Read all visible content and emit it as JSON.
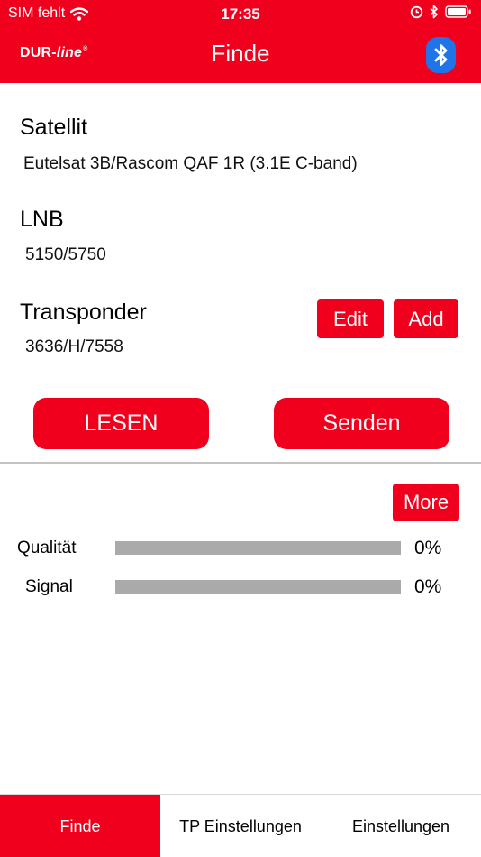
{
  "status_bar": {
    "carrier": "SIM fehlt",
    "time": "17:35"
  },
  "nav": {
    "brand_main": "DUR-",
    "brand_script": "line",
    "brand_mark": "®",
    "title": "Finde"
  },
  "satellite": {
    "label": "Satellit",
    "value": "Eutelsat 3B/Rascom QAF 1R (3.1E C-band)"
  },
  "lnb": {
    "label": "LNB",
    "value": "5150/5750"
  },
  "transponder": {
    "label": "Transponder",
    "value": "3636/H/7558",
    "edit_label": "Edit",
    "add_label": "Add"
  },
  "actions": {
    "read_label": "LESEN",
    "send_label": "Senden"
  },
  "meters": {
    "more_label": "More",
    "quality": {
      "label": "Qualität",
      "value": 0,
      "text": "0%"
    },
    "signal": {
      "label": "Signal",
      "value": 0,
      "text": "0%"
    }
  },
  "tabs": [
    {
      "label": "Finde",
      "active": true
    },
    {
      "label": "TP Einstellungen",
      "active": false
    },
    {
      "label": "Einstellungen",
      "active": false
    }
  ],
  "colors": {
    "accent": "#f0001c",
    "bluetooth": "#1f74e8",
    "meter_track": "#aaaaaa"
  },
  "icons": [
    "wifi-icon",
    "alarm-icon",
    "bluetooth-status-icon",
    "battery-icon",
    "bluetooth-icon"
  ]
}
